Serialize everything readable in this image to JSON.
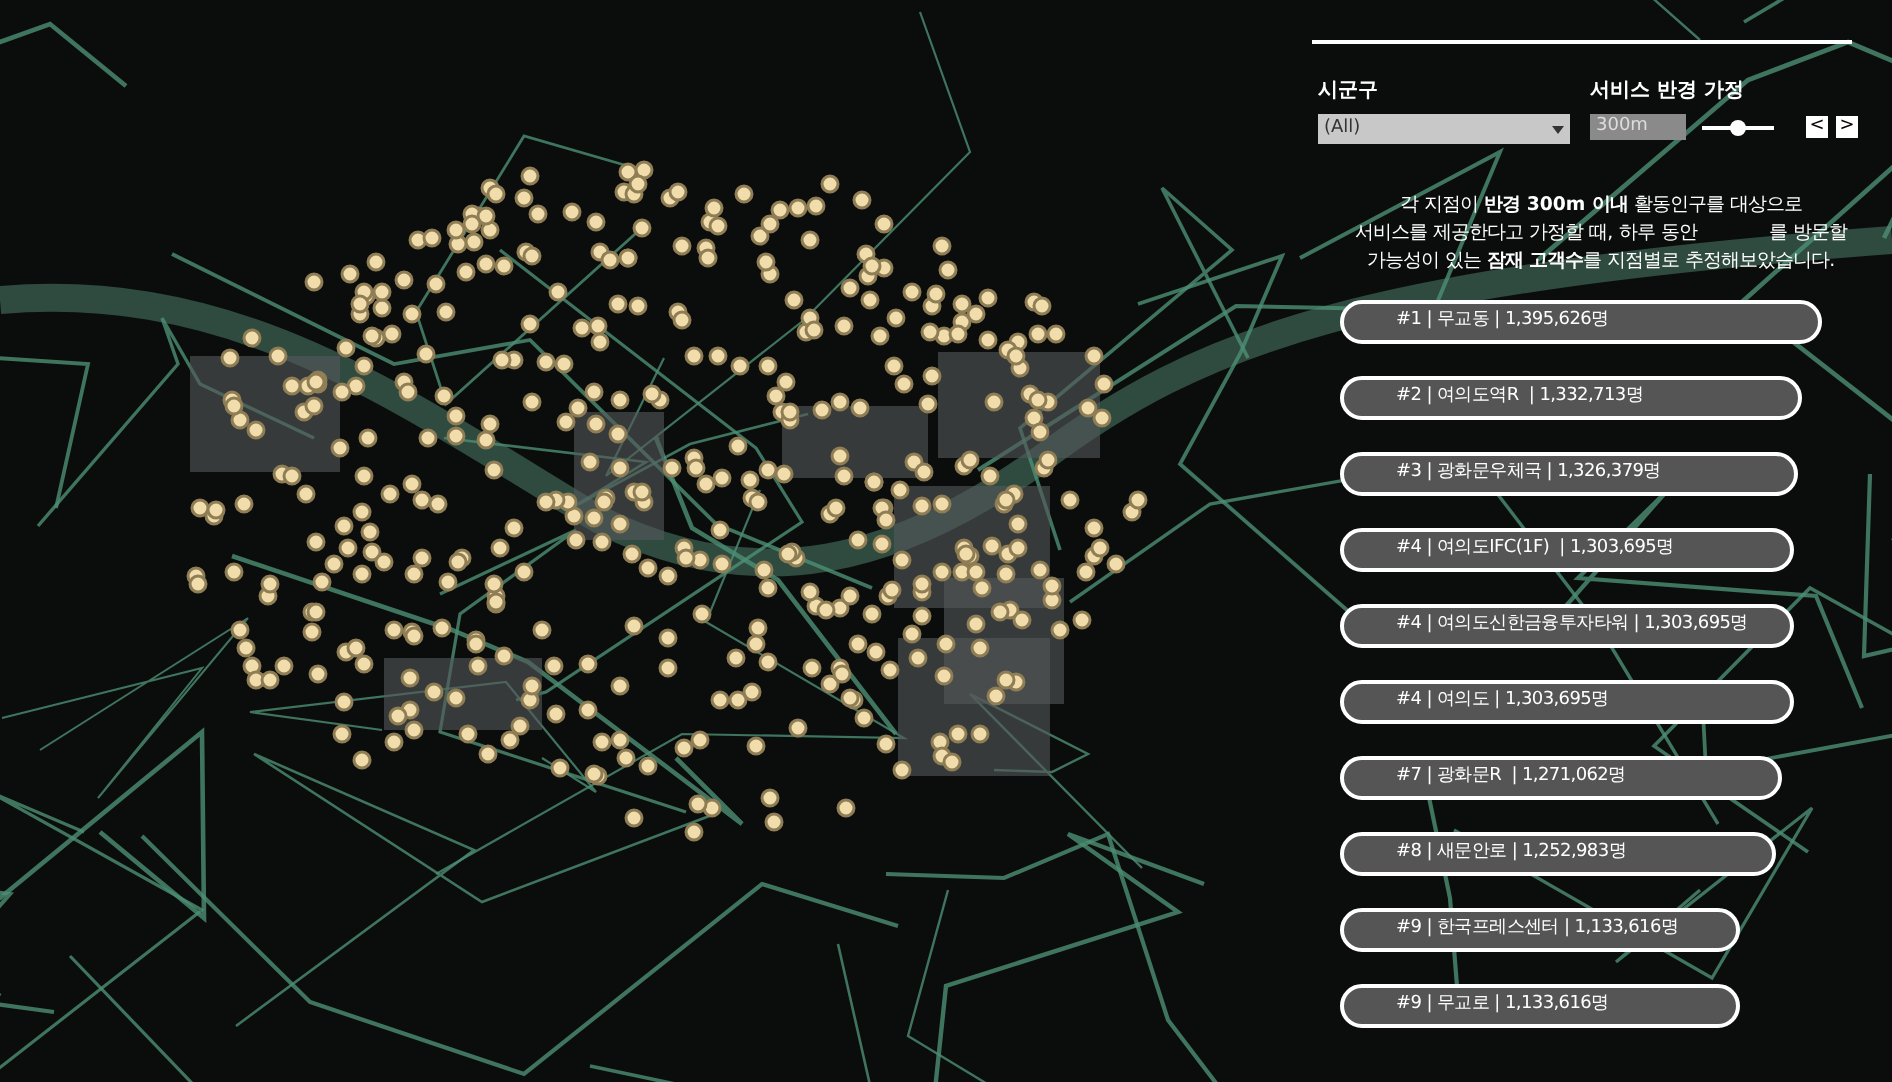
{
  "filters": {
    "district_label": "시군구",
    "district_value": "(All)",
    "radius_label": "서비스 반경 가정",
    "radius_value": "300m",
    "radius_slider": {
      "level": 0.5
    },
    "prev_button": "<",
    "next_button": ">"
  },
  "description": "각 지점이 **반경 300m 이내** 활동인구를 대상으로\n서비스를 제공한다고 가정할 때, 하루 동안            를 방문할\n가능성이 있는 **잠재 고객수**를 지점별로 추정해보았습니다.",
  "ranking": [
    {
      "label": "#1 | 무교동 | 1,395,626명",
      "level": 1
    },
    {
      "label": "#2 | 여의도역R  | 1,332,713명",
      "level": 0.958
    },
    {
      "label": "#3 | 광화문우체국 | 1,326,379명",
      "level": 0.95
    },
    {
      "label": "#4 | 여의도IFC(1F)  | 1,303,695명",
      "level": 0.942
    },
    {
      "label": "#4 | 여의도신한금융투자타워 | 1,303,695명",
      "level": 0.942
    },
    {
      "label": "#4 | 여의도 | 1,303,695명",
      "level": 0.942
    },
    {
      "label": "#7 | 광화문R  | 1,271,062명",
      "level": 0.917
    },
    {
      "label": "#8 | 새문안로 | 1,252,983명",
      "level": 0.904
    },
    {
      "label": "#9 | 한국프레스센터 | 1,133,616명",
      "level": 0.83
    },
    {
      "label": "#9 | 무교로 | 1,133,616명",
      "level": 0.83
    }
  ]
}
